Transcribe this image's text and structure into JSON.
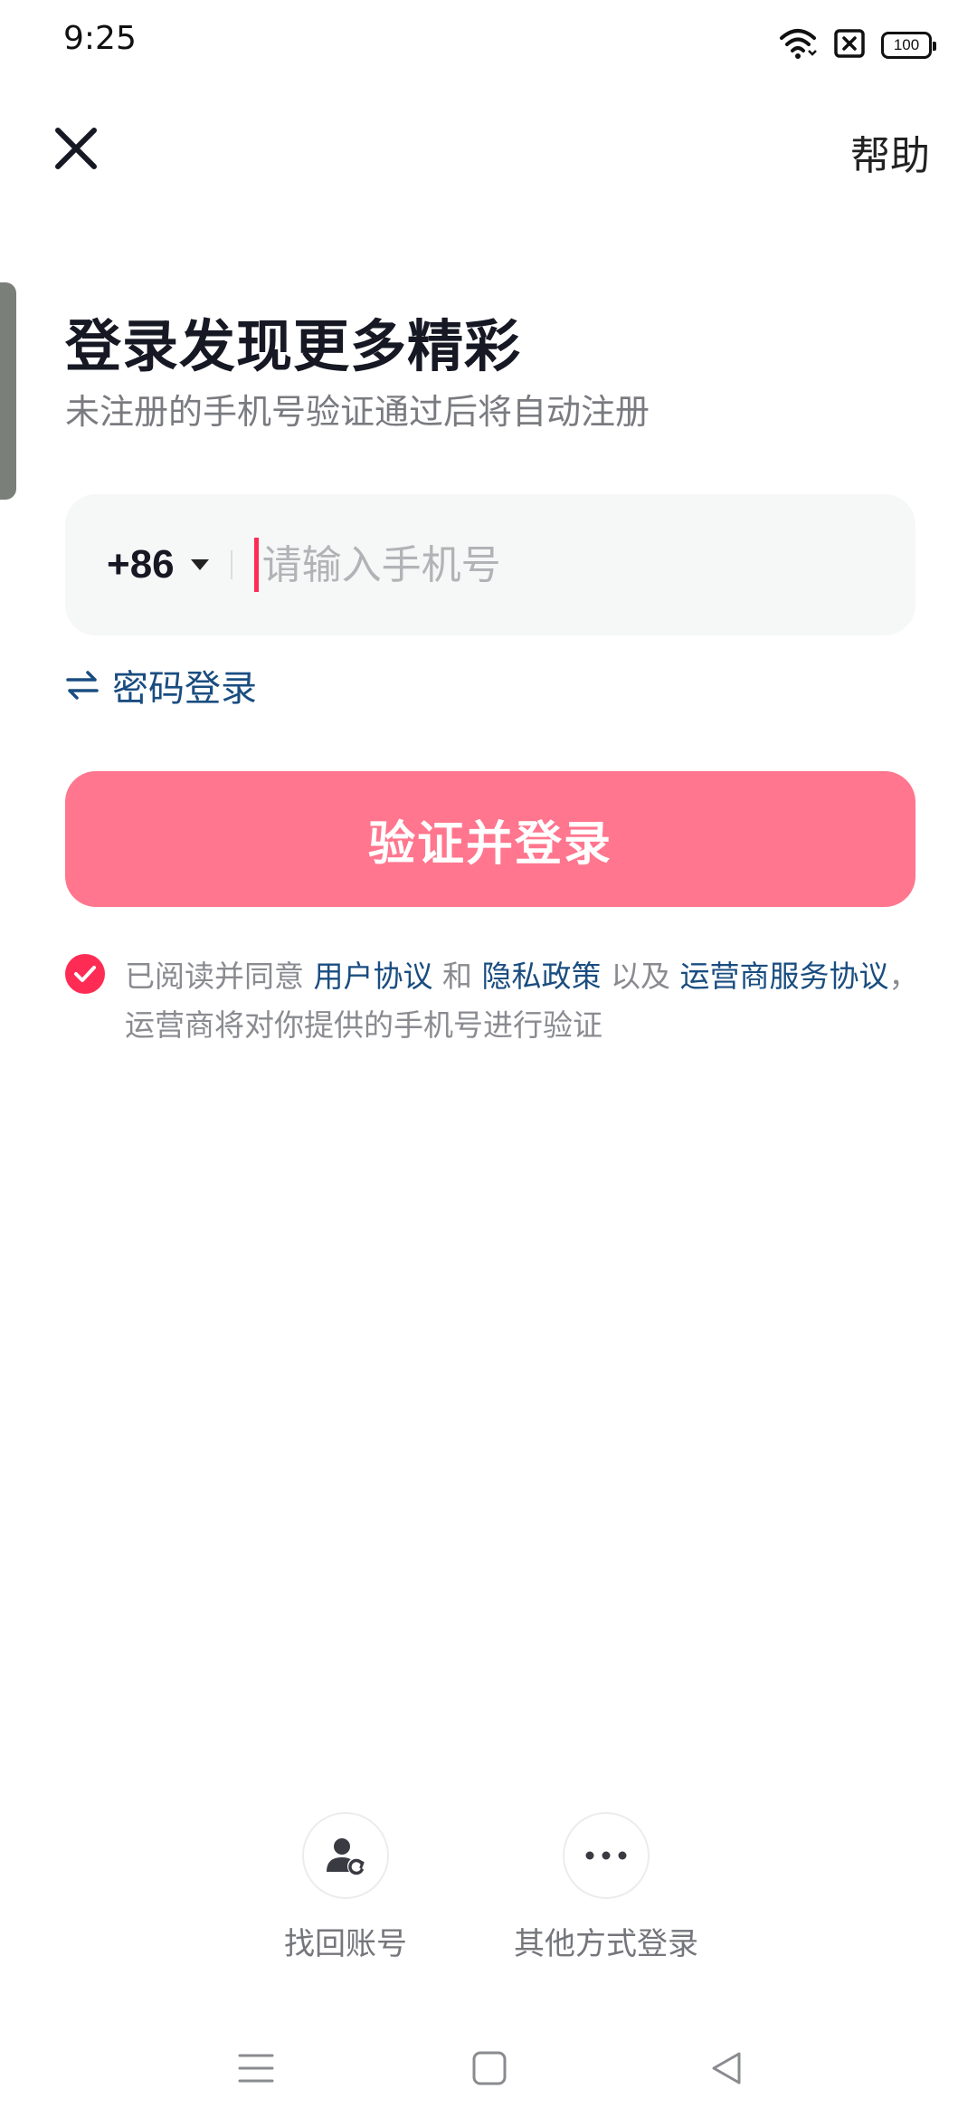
{
  "status_bar": {
    "time": "9:25",
    "battery_level": "100",
    "icons": [
      "wifi-icon",
      "sim-blocked-icon",
      "battery-icon"
    ]
  },
  "top_bar": {
    "close_icon": "close-icon",
    "help_label": "帮助"
  },
  "title": "登录发现更多精彩",
  "subtitle": "未注册的手机号验证通过后将自动注册",
  "phone_input": {
    "country_code": "+86",
    "placeholder": "请输入手机号",
    "value": ""
  },
  "password_login_label": "密码登录",
  "submit_label": "验证并登录",
  "agreement": {
    "checked": true,
    "prefix": "已阅读并同意",
    "user_agreement": "用户协议",
    "and": "和",
    "privacy_policy": "隐私政策",
    "as_well_as": "以及",
    "carrier_agreement": "运营商服务协议",
    "comma": "，",
    "suffix": "运营商将对你提供的手机号进行验证"
  },
  "bottom_options": [
    {
      "label": "找回账号",
      "icon": "account-recovery-icon"
    },
    {
      "label": "其他方式登录",
      "icon": "more-icon"
    }
  ],
  "colors": {
    "primary": "#fe2c55",
    "button": "#ff768e",
    "link": "#1a4d80",
    "title": "#161823"
  }
}
